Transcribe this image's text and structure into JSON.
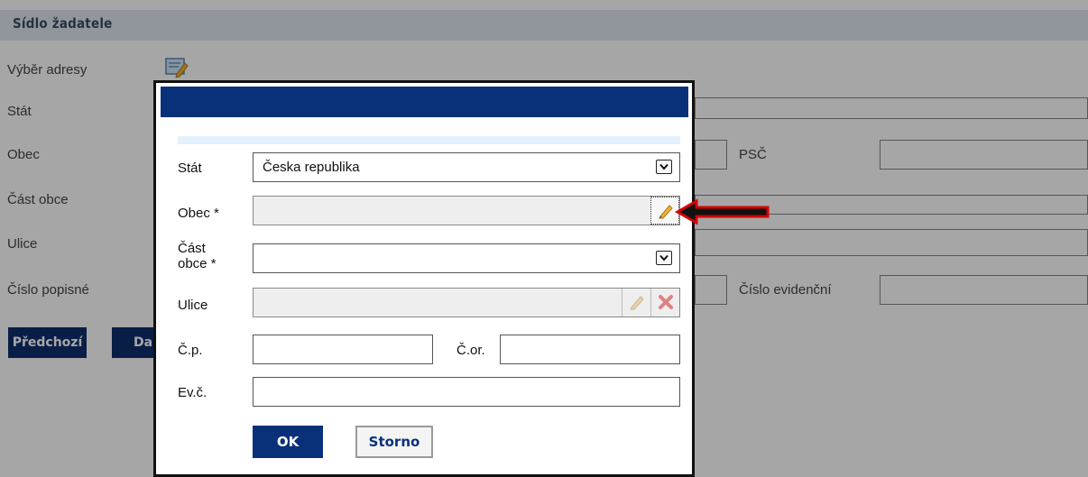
{
  "section": {
    "title": "Sídlo žadatele"
  },
  "background_form": {
    "labels": [
      "Výběr adresy",
      "Stát",
      "Obec",
      "Část obce",
      "Ulice",
      "Číslo popisné"
    ],
    "psc_label": "PSČ",
    "cislo_evidencni_label": "Číslo evidenční",
    "prev_button": "Předchozí",
    "next_button": "Další"
  },
  "dialog": {
    "stat_label": "Stát",
    "stat_value": "Česka republika",
    "obec_label": "Obec *",
    "cast_obce_label_1": "Část",
    "cast_obce_label_2": "obce *",
    "ulice_label": "Ulice",
    "cp_label": "Č.p.",
    "cor_label": "Č.or.",
    "evc_label": "Ev.č.",
    "ok_button": "OK",
    "storno_button": "Storno"
  },
  "colors": {
    "dialog_titlebar": "#08317a",
    "arrow": "#d40000",
    "overlay": "rgba(0,0,0,0.35)"
  },
  "icons": {
    "address_select": "address-picker-icon",
    "edit": "pencil-icon",
    "clear": "red-x-icon",
    "dropdown": "chevron-down-icon",
    "annotation": "red-arrow-icon"
  }
}
